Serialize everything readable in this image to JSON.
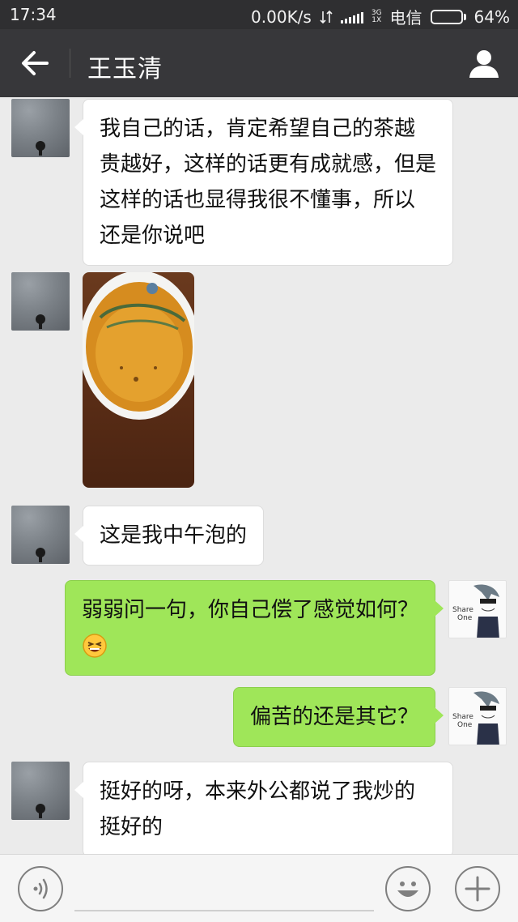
{
  "status_bar": {
    "time": "17:34",
    "speed": "0.00K/s",
    "network_top": "3G",
    "network_bottom": "1X",
    "carrier": "电信",
    "battery_text": "64%",
    "battery_level": 0.64
  },
  "nav": {
    "title": "王玉清",
    "back_icon": "arrow-left-icon",
    "profile_icon": "person-icon"
  },
  "messages": [
    {
      "side": "left",
      "type": "text",
      "text": [
        "我自己的话，肯定希望自己的茶越",
        "贵越好，这样的话更有成就感，但是",
        "这样的话也显得我很不懂事，所以",
        "还是你说吧"
      ]
    },
    {
      "side": "left",
      "type": "image"
    },
    {
      "side": "left",
      "type": "text",
      "text": [
        "这是我中午泡的"
      ]
    },
    {
      "side": "right",
      "type": "text",
      "text": [
        "弱弱问一句，你自己偿了感觉如何？"
      ],
      "emoji": "grinning-face-icon",
      "avatar_text": "Share One"
    },
    {
      "side": "right",
      "type": "text",
      "text": [
        "偏苦的还是其它？"
      ],
      "avatar_text": "Share One"
    },
    {
      "side": "left",
      "type": "text",
      "text": [
        "挺好的呀，本来外公都说了我炒的",
        "挺好的"
      ]
    }
  ],
  "input_bar": {
    "voice_icon": "voice-icon",
    "emoji_icon": "smiley-icon",
    "add_icon": "plus-icon"
  },
  "colors": {
    "nav_bg": "#37373a",
    "chat_bg": "#ebebeb",
    "my_bubble": "#9fe659",
    "their_bubble": "#ffffff"
  }
}
